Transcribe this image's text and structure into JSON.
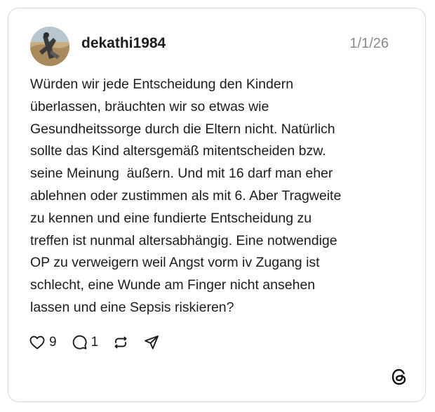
{
  "post": {
    "username": "dekathi1984",
    "date": "1/1/26",
    "lines": [
      "Würden wir jede Entscheidung den Kindern",
      "überlassen, bräuchten wir so etwas wie",
      "Gesundheitssorge durch die Eltern nicht. Natürlich",
      "sollte das Kind altersgemäß mitentscheiden bzw.",
      "seine Meinung  äußern. Und mit 16 darf man eher",
      "ablehnen oder zustimmen als mit 6. Aber Tragweite",
      "zu kennen und eine fundierte Entscheidung zu",
      "treffen ist nunmal altersabhängig. Eine notwendige",
      "OP zu verweigern weil Angst vorm iv Zugang ist",
      "schlecht, eine Wunde am Finger nicht ansehen",
      "lassen und eine Sepsis riskieren?"
    ]
  },
  "actions": {
    "like_count": "9",
    "reply_count": "1",
    "icons": [
      "heart-icon",
      "comment-icon",
      "repost-icon",
      "share-icon"
    ]
  },
  "brand": {
    "logo": "threads-logo-icon"
  }
}
